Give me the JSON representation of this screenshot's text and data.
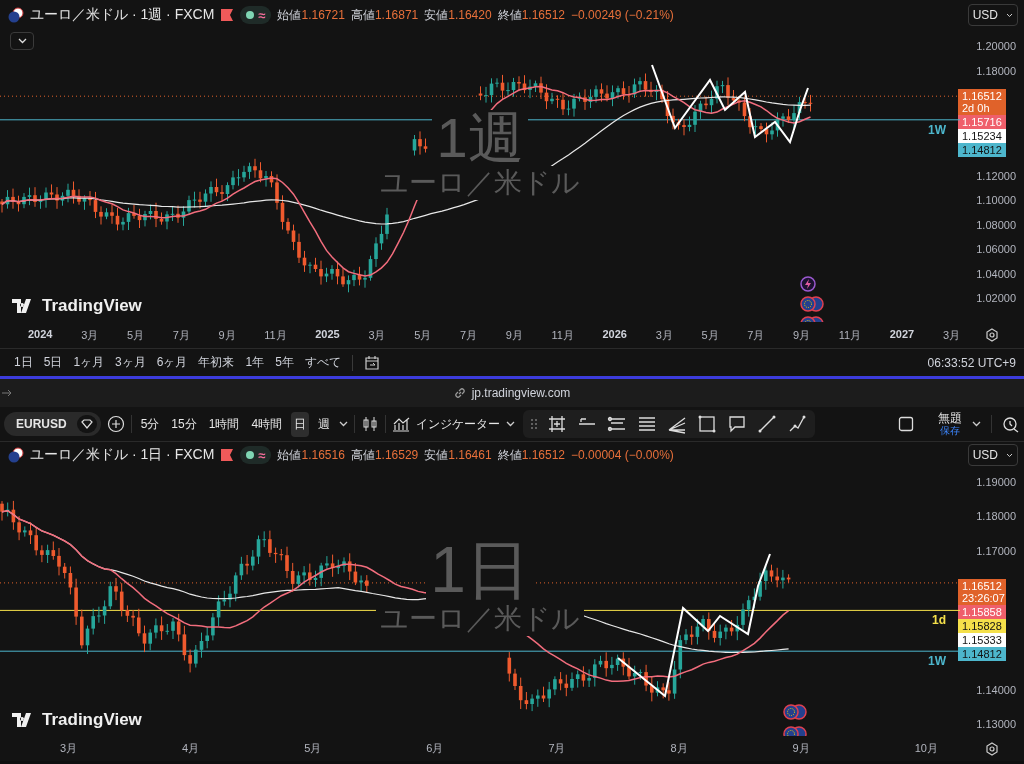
{
  "top_chart": {
    "header": {
      "title": "ユーロ／米ドル · 1週 · FXCM",
      "status_symbol": "≈",
      "ohlc": [
        {
          "label": "始値",
          "value": "1.16721"
        },
        {
          "label": "高値",
          "value": "1.16871"
        },
        {
          "label": "安値",
          "value": "1.16420"
        },
        {
          "label": "終値",
          "value": "1.16512"
        }
      ],
      "change": "−0.00249 (−0.21%)",
      "currency": "USD"
    },
    "watermark": {
      "interval": "1週",
      "name": "ユーロ／米ドル"
    },
    "logo": "TradingView",
    "levels": [
      {
        "label": "1W",
        "color": "#4db6cc"
      }
    ],
    "price_axis": {
      "labels_above": [
        "1.20000",
        "1.18000"
      ],
      "tags": [
        {
          "price": "1.16512",
          "countdown": "2d 0h",
          "color": "#e0622a"
        },
        {
          "price": "1.15716",
          "color": "#ef5f6b"
        },
        {
          "price": "1.15234",
          "color": "#ffffff"
        },
        {
          "price": "1.14812",
          "color": "#4db6cc"
        }
      ],
      "labels_below": [
        "1.12000",
        "1.10000",
        "1.08000",
        "1.06000",
        "1.04000",
        "1.02000"
      ]
    },
    "time_axis": [
      {
        "text": "2024",
        "kind": "year"
      },
      {
        "text": "3月",
        "kind": "month"
      },
      {
        "text": "5月",
        "kind": "month"
      },
      {
        "text": "7月",
        "kind": "month"
      },
      {
        "text": "9月",
        "kind": "month"
      },
      {
        "text": "11月",
        "kind": "month"
      },
      {
        "text": "2025",
        "kind": "year"
      },
      {
        "text": "3月",
        "kind": "month"
      },
      {
        "text": "5月",
        "kind": "month"
      },
      {
        "text": "7月",
        "kind": "month"
      },
      {
        "text": "9月",
        "kind": "month"
      },
      {
        "text": "11月",
        "kind": "month"
      },
      {
        "text": "2026",
        "kind": "year"
      },
      {
        "text": "3月",
        "kind": "month"
      },
      {
        "text": "5月",
        "kind": "month"
      },
      {
        "text": "7月",
        "kind": "month"
      },
      {
        "text": "9月",
        "kind": "month"
      },
      {
        "text": "11月",
        "kind": "month"
      },
      {
        "text": "2027",
        "kind": "year"
      },
      {
        "text": "3月",
        "kind": "month"
      }
    ]
  },
  "range_bar": {
    "ranges": [
      "1日",
      "5日",
      "1ヶ月",
      "3ヶ月",
      "6ヶ月",
      "年初来",
      "1年",
      "5年",
      "すべて"
    ],
    "clock": "06:33:52 UTC+9"
  },
  "address_bar": {
    "url": "jp.tradingview.com"
  },
  "toolbar": {
    "symbol": "EURUSD",
    "intervals": [
      {
        "label": "5分",
        "selected": false
      },
      {
        "label": "15分",
        "selected": false
      },
      {
        "label": "1時間",
        "selected": false
      },
      {
        "label": "4時間",
        "selected": false
      },
      {
        "label": "日",
        "selected": true
      },
      {
        "label": "週",
        "selected": false
      }
    ],
    "indicators": "インジケーター",
    "layout_name": "無題",
    "save_label": "保存"
  },
  "bottom_chart": {
    "header": {
      "title": "ユーロ／米ドル · 1日 · FXCM",
      "status_symbol": "≈",
      "ohlc": [
        {
          "label": "始値",
          "value": "1.16516"
        },
        {
          "label": "高値",
          "value": "1.16529"
        },
        {
          "label": "安値",
          "value": "1.16461"
        },
        {
          "label": "終値",
          "value": "1.16512"
        }
      ],
      "change": "−0.00004 (−0.00%)",
      "currency": "USD"
    },
    "watermark": {
      "interval": "1日",
      "name": "ユーロ／米ドル"
    },
    "logo": "TradingView",
    "levels": [
      {
        "label": "1d",
        "color": "#f5e04a"
      },
      {
        "label": "1W",
        "color": "#4db6cc"
      }
    ],
    "price_axis": {
      "labels_above": [
        "1.19000",
        "1.18000",
        "1.17000"
      ],
      "tags": [
        {
          "price": "1.16512",
          "countdown": "23:26:07",
          "color": "#e0622a"
        },
        {
          "price": "1.15858",
          "color": "#ef5f6b"
        },
        {
          "price": "1.15828",
          "color": "#f5e04a"
        },
        {
          "price": "1.15333",
          "color": "#ffffff"
        },
        {
          "price": "1.14812",
          "color": "#4db6cc"
        }
      ],
      "labels_below": [
        "1.14000",
        "1.13000"
      ]
    },
    "time_axis": [
      {
        "text": "3月",
        "kind": "month"
      },
      {
        "text": "4月",
        "kind": "month"
      },
      {
        "text": "5月",
        "kind": "month"
      },
      {
        "text": "6月",
        "kind": "month"
      },
      {
        "text": "7月",
        "kind": "month"
      },
      {
        "text": "8月",
        "kind": "month"
      },
      {
        "text": "9月",
        "kind": "month"
      },
      {
        "text": "10月",
        "kind": "month"
      }
    ]
  }
}
